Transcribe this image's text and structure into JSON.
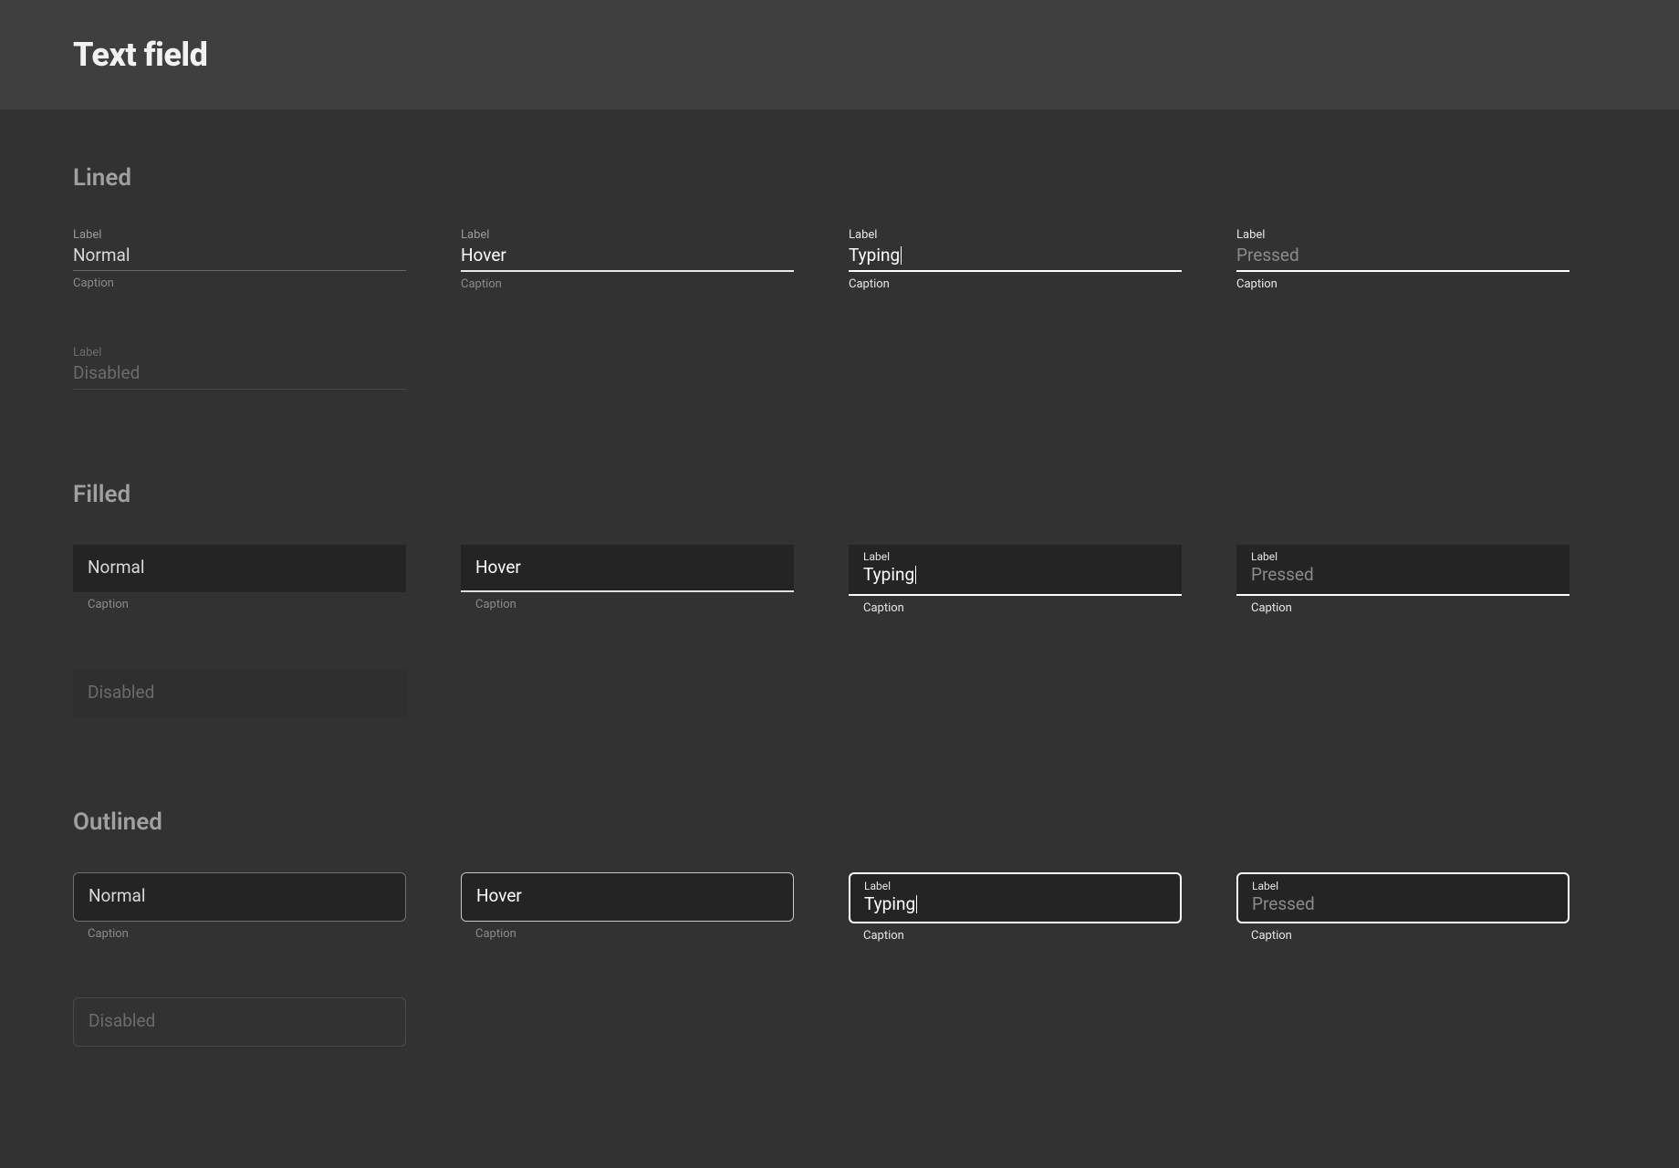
{
  "header": {
    "title": "Text field"
  },
  "sections": {
    "lined": {
      "title": "Lined",
      "normal": {
        "label": "Label",
        "value": "Normal",
        "caption": "Caption"
      },
      "hover": {
        "label": "Label",
        "value": "Hover",
        "caption": "Caption"
      },
      "typing": {
        "label": "Label",
        "value": "Typing",
        "caption": "Caption"
      },
      "pressed": {
        "label": "Label",
        "value": "Pressed",
        "caption": "Caption"
      },
      "disabled": {
        "label": "Label",
        "value": "Disabled"
      }
    },
    "filled": {
      "title": "Filled",
      "normal": {
        "value": "Normal",
        "caption": "Caption"
      },
      "hover": {
        "value": "Hover",
        "caption": "Caption"
      },
      "typing": {
        "label": "Label",
        "value": "Typing",
        "caption": "Caption"
      },
      "pressed": {
        "label": "Label",
        "value": "Pressed",
        "caption": "Caption"
      },
      "disabled": {
        "value": "Disabled"
      }
    },
    "outlined": {
      "title": "Outlined",
      "normal": {
        "value": "Normal",
        "caption": "Caption"
      },
      "hover": {
        "value": "Hover",
        "caption": "Caption"
      },
      "typing": {
        "label": "Label",
        "value": "Typing",
        "caption": "Caption"
      },
      "pressed": {
        "label": "Label",
        "value": "Pressed",
        "caption": "Caption"
      },
      "disabled": {
        "value": "Disabled"
      }
    }
  }
}
